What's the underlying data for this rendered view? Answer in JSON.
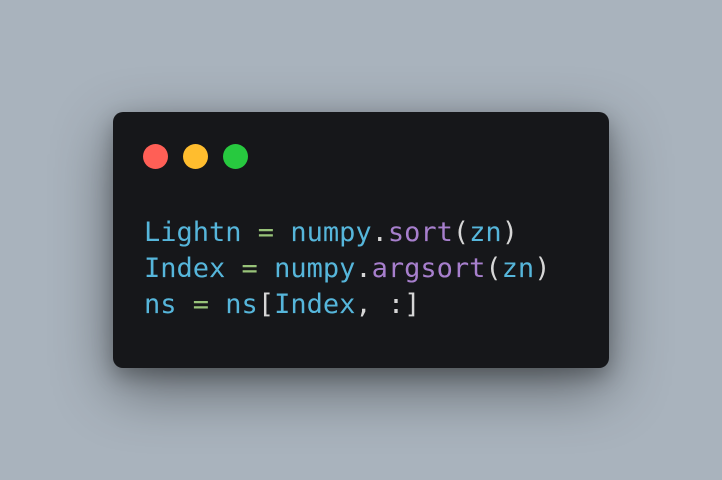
{
  "window": {
    "dots": [
      {
        "name": "close-dot",
        "color": "#ff5f56"
      },
      {
        "name": "minimize-dot",
        "color": "#ffbd2e"
      },
      {
        "name": "maximize-dot",
        "color": "#27c93f"
      }
    ]
  },
  "colors": {
    "identifier": "#56b6db",
    "operator": "#98c379",
    "function": "#a77fcd",
    "punctuation": "#d6d6d6"
  },
  "code": {
    "lines": [
      {
        "tokens": [
          {
            "text": "Lightn",
            "kind": "identifier"
          },
          {
            "text": " = ",
            "kind": "operator"
          },
          {
            "text": "numpy",
            "kind": "identifier"
          },
          {
            "text": ".",
            "kind": "punctuation"
          },
          {
            "text": "sort",
            "kind": "function"
          },
          {
            "text": "(",
            "kind": "punctuation"
          },
          {
            "text": "zn",
            "kind": "identifier"
          },
          {
            "text": ")",
            "kind": "punctuation"
          }
        ]
      },
      {
        "tokens": [
          {
            "text": "Index",
            "kind": "identifier"
          },
          {
            "text": " = ",
            "kind": "operator"
          },
          {
            "text": "numpy",
            "kind": "identifier"
          },
          {
            "text": ".",
            "kind": "punctuation"
          },
          {
            "text": "argsort",
            "kind": "function"
          },
          {
            "text": "(",
            "kind": "punctuation"
          },
          {
            "text": "zn",
            "kind": "identifier"
          },
          {
            "text": ")",
            "kind": "punctuation"
          }
        ]
      },
      {
        "tokens": [
          {
            "text": "ns",
            "kind": "identifier"
          },
          {
            "text": " = ",
            "kind": "operator"
          },
          {
            "text": "ns",
            "kind": "identifier"
          },
          {
            "text": "[",
            "kind": "punctuation"
          },
          {
            "text": "Index",
            "kind": "identifier"
          },
          {
            "text": ", :]",
            "kind": "punctuation"
          }
        ]
      }
    ]
  }
}
